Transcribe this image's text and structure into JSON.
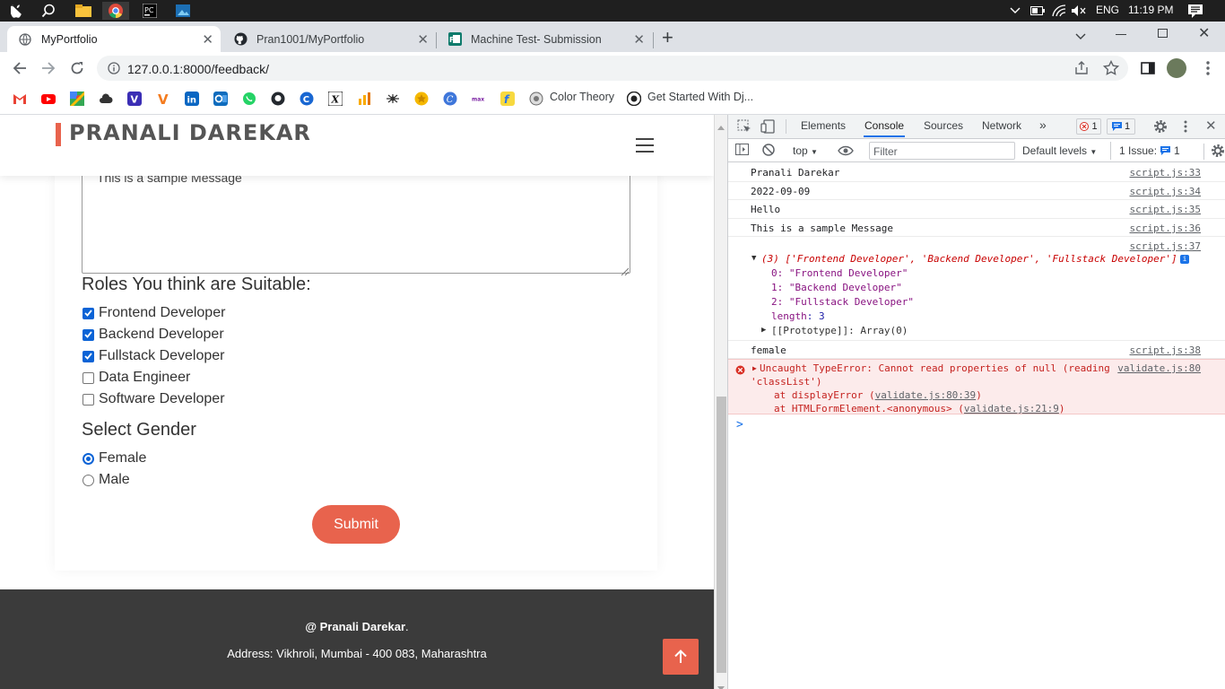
{
  "taskbar": {
    "lang": "ENG",
    "time": "11:19 PM"
  },
  "browser": {
    "tabs": [
      {
        "title": "MyPortfolio"
      },
      {
        "title": "Pran1001/MyPortfolio"
      },
      {
        "title": "Machine Test- Submission"
      }
    ],
    "url": "127.0.0.1:8000/feedback/",
    "bookmarks": [
      "Color Theory",
      "Get Started With Dj..."
    ]
  },
  "site": {
    "brand": "PRANALI DAREKAR",
    "message_value": "This is a sample Message",
    "roles_title": "Roles You think are Suitable:",
    "roles": [
      {
        "label": "Frontend Developer",
        "checked": true
      },
      {
        "label": "Backend Developer",
        "checked": true
      },
      {
        "label": "Fullstack Developer",
        "checked": true
      },
      {
        "label": "Data Engineer",
        "checked": false
      },
      {
        "label": "Software Developer",
        "checked": false
      }
    ],
    "gender_title": "Select Gender",
    "genders": [
      {
        "label": "Female",
        "selected": true
      },
      {
        "label": "Male",
        "selected": false
      }
    ],
    "submit_label": "Submit",
    "footer": {
      "at": "@ ",
      "name": "Pranali Darekar",
      "dot": ".",
      "address": "Address: Vikhroli, Mumbai - 400 083, Maharashtra"
    }
  },
  "devtools": {
    "tabs": [
      "Elements",
      "Console",
      "Sources",
      "Network"
    ],
    "error_count": "1",
    "msg_count": "1",
    "context": "top",
    "filter_placeholder": "Filter",
    "levels": "Default levels",
    "issues": "1 Issue:",
    "issues_count": "1",
    "logs": [
      {
        "text": "Pranali Darekar",
        "src": "script.js:33"
      },
      {
        "text": "2022-09-09",
        "src": "script.js:34"
      },
      {
        "text": "Hello",
        "src": "script.js:35"
      },
      {
        "text": "This is a sample Message",
        "src": "script.js:36"
      },
      {
        "text": "",
        "src": "script.js:37"
      },
      {
        "text": "female",
        "src": "script.js:38"
      }
    ],
    "array": {
      "summary": "(3) ['Frontend Developer', 'Backend Developer', 'Fullstack Developer']",
      "items": [
        "0: \"Frontend Developer\"",
        "1: \"Backend Developer\"",
        "2: \"Fullstack Developer\""
      ],
      "length_key": "length",
      "length_val": ": 3",
      "proto": "[[Prototype]]: Array(0)"
    },
    "error": {
      "line1": "Uncaught TypeError: Cannot read properties of null (reading",
      "line2": "'classList')",
      "src": "validate.js:80",
      "stack1_pre": "at displayError (",
      "stack1_link": "validate.js:80:39",
      "stack1_post": ")",
      "stack2_pre": "at HTMLFormElement.<anonymous> (",
      "stack2_link": "validate.js:21:9",
      "stack2_post": ")"
    },
    "prompt": ">"
  }
}
